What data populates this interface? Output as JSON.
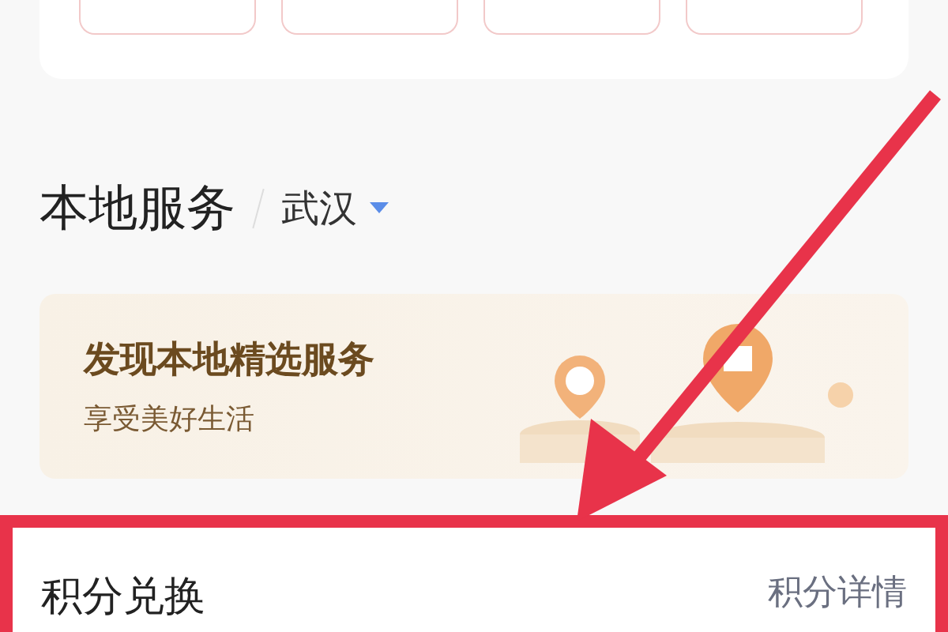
{
  "local_service": {
    "title": "本地服务",
    "city": "武汉",
    "banner": {
      "headline": "发现本地精选服务",
      "subtitle": "享受美好生活"
    }
  },
  "points_exchange": {
    "title": "积分兑换",
    "link": "积分详情"
  }
}
